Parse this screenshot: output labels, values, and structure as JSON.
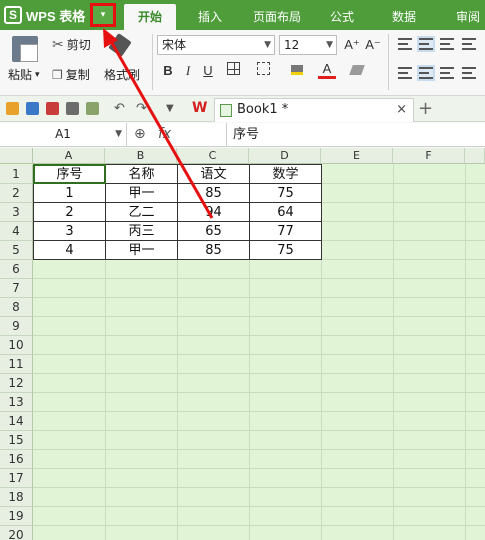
{
  "app": {
    "logo": "S",
    "name": "WPS 表格",
    "menu_arrow": "▾"
  },
  "menu_tabs": [
    "开始",
    "插入",
    "页面布局",
    "公式",
    "数据",
    "审阅"
  ],
  "ribbon": {
    "paste": "粘贴",
    "paste_arrow": "▾",
    "cut": "剪切",
    "copy": "复制",
    "format_painter": "格式刷",
    "font_name": "宋体",
    "font_size": "12",
    "grow_font": "A⁺",
    "shrink_font": "A⁻",
    "bold": "B",
    "italic": "I",
    "underline": "U",
    "font_color_letter": "A"
  },
  "doc_tab": {
    "title": "Book1 *",
    "close": "×",
    "new": "+"
  },
  "formula_bar": {
    "cell_ref": "A1",
    "fx": "fx",
    "content": "序号"
  },
  "columns": [
    "A",
    "B",
    "C",
    "D",
    "E",
    "F"
  ],
  "rows": [
    "1",
    "2",
    "3",
    "4",
    "5",
    "6",
    "7",
    "8",
    "9",
    "10",
    "11",
    "12",
    "13",
    "14",
    "15",
    "16",
    "17",
    "18",
    "19",
    "20"
  ],
  "table": {
    "headers": [
      "序号",
      "名称",
      "语文",
      "数学"
    ],
    "data": [
      [
        "1",
        "甲一",
        "85",
        "75"
      ],
      [
        "2",
        "乙二",
        "94",
        "64"
      ],
      [
        "3",
        "丙三",
        "65",
        "77"
      ],
      [
        "4",
        "甲一",
        "85",
        "75"
      ]
    ]
  },
  "colors": {
    "title_green": "#4e9d3a",
    "sheet_green": "#e2f4d6",
    "annotation_red": "#e61010"
  }
}
